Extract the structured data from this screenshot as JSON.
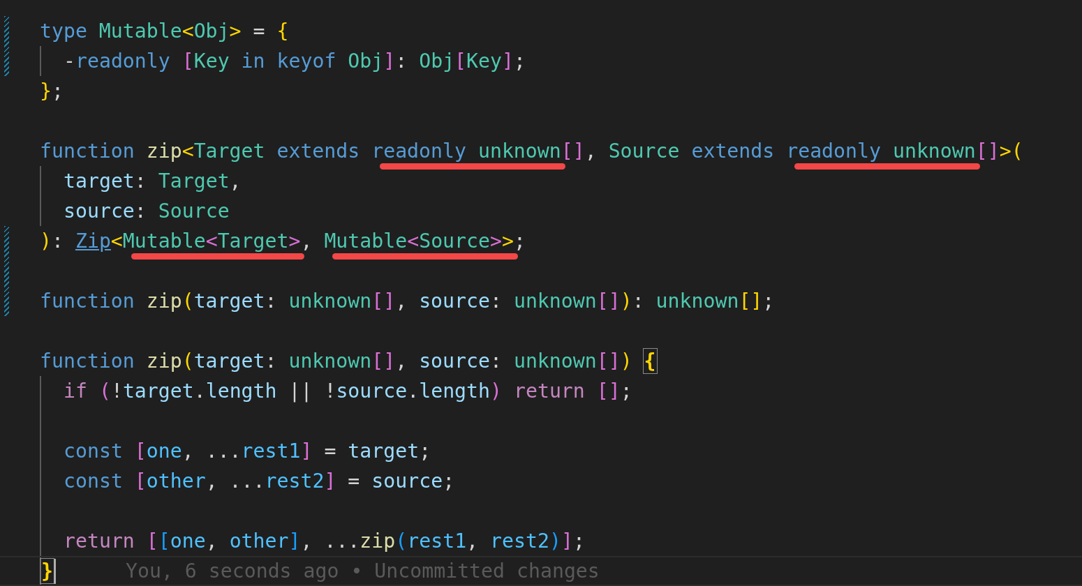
{
  "editor": {
    "lines": [
      {
        "modified": true,
        "indent": false,
        "tokens": [
          {
            "t": "type ",
            "color": "#569cd6"
          },
          {
            "t": "Mutable",
            "color": "#4ec9b0"
          },
          {
            "t": "<",
            "color": "#ffd700"
          },
          {
            "t": "Obj",
            "color": "#4ec9b0"
          },
          {
            "t": ">",
            "color": "#ffd700"
          },
          {
            "t": " = ",
            "color": "#d4d4d4"
          },
          {
            "t": "{",
            "color": "#ffd700"
          }
        ]
      },
      {
        "modified": true,
        "indent": true,
        "tokens": [
          {
            "t": "-",
            "color": "#d4d4d4"
          },
          {
            "t": "readonly ",
            "color": "#569cd6"
          },
          {
            "t": "[",
            "color": "#da70d6"
          },
          {
            "t": "Key ",
            "color": "#4ec9b0"
          },
          {
            "t": "in keyof ",
            "color": "#569cd6"
          },
          {
            "t": "Obj",
            "color": "#4ec9b0"
          },
          {
            "t": "]",
            "color": "#da70d6"
          },
          {
            "t": ": ",
            "color": "#d4d4d4"
          },
          {
            "t": "Obj",
            "color": "#4ec9b0"
          },
          {
            "t": "[",
            "color": "#da70d6"
          },
          {
            "t": "Key",
            "color": "#4ec9b0"
          },
          {
            "t": "]",
            "color": "#da70d6"
          },
          {
            "t": ";",
            "color": "#d4d4d4"
          }
        ]
      },
      {
        "modified": false,
        "indent": false,
        "tokens": [
          {
            "t": "}",
            "color": "#ffd700"
          },
          {
            "t": ";",
            "color": "#d4d4d4"
          }
        ]
      },
      {
        "modified": false,
        "indent": false
      },
      {
        "modified": false,
        "indent": false,
        "tokens": [
          {
            "t": "function ",
            "color": "#569cd6"
          },
          {
            "t": "zip",
            "color": "#dcdcaa"
          },
          {
            "t": "<",
            "color": "#ffd700"
          },
          {
            "t": "Target ",
            "color": "#4ec9b0"
          },
          {
            "t": "extends ",
            "color": "#569cd6"
          },
          {
            "marked": true,
            "tokens": [
              {
                "t": "readonly ",
                "color": "#569cd6"
              },
              {
                "t": "unknown",
                "color": "#4ec9b0"
              }
            ]
          },
          {
            "t": "[]",
            "color": "#da70d6"
          },
          {
            "t": ", ",
            "color": "#d4d4d4"
          },
          {
            "t": "Source ",
            "color": "#4ec9b0"
          },
          {
            "t": "extends ",
            "color": "#569cd6"
          },
          {
            "marked": true,
            "tokens": [
              {
                "t": "readonly ",
                "color": "#569cd6"
              },
              {
                "t": "unknown",
                "color": "#4ec9b0"
              }
            ]
          },
          {
            "t": "[]",
            "color": "#da70d6"
          },
          {
            "t": ">",
            "color": "#ffd700"
          },
          {
            "t": "(",
            "color": "#ffd700"
          }
        ]
      },
      {
        "modified": false,
        "indent": true,
        "tokens": [
          {
            "t": "target",
            "color": "#9cdcfe"
          },
          {
            "t": ": ",
            "color": "#d4d4d4"
          },
          {
            "t": "Target",
            "color": "#4ec9b0"
          },
          {
            "t": ",",
            "color": "#d4d4d4"
          }
        ]
      },
      {
        "modified": false,
        "indent": true,
        "tokens": [
          {
            "t": "source",
            "color": "#9cdcfe"
          },
          {
            "t": ": ",
            "color": "#d4d4d4"
          },
          {
            "t": "Source",
            "color": "#4ec9b0"
          }
        ]
      },
      {
        "modified": true,
        "indent": false,
        "tokens": [
          {
            "t": ")",
            "color": "#ffd700"
          },
          {
            "t": ": ",
            "color": "#d4d4d4"
          },
          {
            "t": "Zip",
            "color": "#569cd6",
            "link": true
          },
          {
            "t": "<",
            "color": "#ffd700"
          },
          {
            "marked": true,
            "tokens": [
              {
                "t": "Mutable",
                "color": "#4ec9b0"
              },
              {
                "t": "<",
                "color": "#da70d6"
              },
              {
                "t": "Target",
                "color": "#4ec9b0"
              },
              {
                "t": ">",
                "color": "#da70d6"
              }
            ]
          },
          {
            "t": ", ",
            "color": "#d4d4d4"
          },
          {
            "marked": true,
            "tokens": [
              {
                "t": "Mutable",
                "color": "#4ec9b0"
              },
              {
                "t": "<",
                "color": "#da70d6"
              },
              {
                "t": "Source",
                "color": "#4ec9b0"
              },
              {
                "t": ">",
                "color": "#da70d6"
              },
              {
                "t": ">",
                "color": "#ffd700"
              }
            ]
          },
          {
            "t": ";",
            "color": "#d4d4d4"
          }
        ]
      },
      {
        "modified": true,
        "indent": false
      },
      {
        "modified": true,
        "indent": false,
        "tokens": [
          {
            "t": "function ",
            "color": "#569cd6"
          },
          {
            "t": "zip",
            "color": "#dcdcaa"
          },
          {
            "t": "(",
            "color": "#ffd700"
          },
          {
            "t": "target",
            "color": "#9cdcfe"
          },
          {
            "t": ": ",
            "color": "#d4d4d4"
          },
          {
            "t": "unknown",
            "color": "#4ec9b0"
          },
          {
            "t": "[]",
            "color": "#da70d6"
          },
          {
            "t": ", ",
            "color": "#d4d4d4"
          },
          {
            "t": "source",
            "color": "#9cdcfe"
          },
          {
            "t": ": ",
            "color": "#d4d4d4"
          },
          {
            "t": "unknown",
            "color": "#4ec9b0"
          },
          {
            "t": "[]",
            "color": "#da70d6"
          },
          {
            "t": ")",
            "color": "#ffd700"
          },
          {
            "t": ": ",
            "color": "#d4d4d4"
          },
          {
            "t": "unknown",
            "color": "#4ec9b0"
          },
          {
            "t": "[]",
            "color": "#ffd700"
          },
          {
            "t": ";",
            "color": "#d4d4d4"
          }
        ]
      },
      {
        "modified": false,
        "indent": false
      },
      {
        "modified": false,
        "indent": false,
        "tokens": [
          {
            "t": "function ",
            "color": "#569cd6"
          },
          {
            "t": "zip",
            "color": "#dcdcaa"
          },
          {
            "t": "(",
            "color": "#ffd700"
          },
          {
            "t": "target",
            "color": "#9cdcfe"
          },
          {
            "t": ": ",
            "color": "#d4d4d4"
          },
          {
            "t": "unknown",
            "color": "#4ec9b0"
          },
          {
            "t": "[]",
            "color": "#da70d6"
          },
          {
            "t": ", ",
            "color": "#d4d4d4"
          },
          {
            "t": "source",
            "color": "#9cdcfe"
          },
          {
            "t": ": ",
            "color": "#d4d4d4"
          },
          {
            "t": "unknown",
            "color": "#4ec9b0"
          },
          {
            "t": "[]",
            "color": "#da70d6"
          },
          {
            "t": ") ",
            "color": "#ffd700"
          },
          {
            "t": "{",
            "color": "#ffd700",
            "matched": true
          }
        ]
      },
      {
        "modified": false,
        "indent": true,
        "tokens": [
          {
            "t": "if ",
            "color": "#c586c0"
          },
          {
            "t": "(",
            "color": "#da70d6"
          },
          {
            "t": "!",
            "color": "#d4d4d4"
          },
          {
            "t": "target",
            "color": "#9cdcfe"
          },
          {
            "t": ".",
            "color": "#d4d4d4"
          },
          {
            "t": "length",
            "color": "#9cdcfe"
          },
          {
            "t": " || !",
            "color": "#d4d4d4"
          },
          {
            "t": "source",
            "color": "#9cdcfe"
          },
          {
            "t": ".",
            "color": "#d4d4d4"
          },
          {
            "t": "length",
            "color": "#9cdcfe"
          },
          {
            "t": ") ",
            "color": "#da70d6"
          },
          {
            "t": "return ",
            "color": "#c586c0"
          },
          {
            "t": "[]",
            "color": "#da70d6"
          },
          {
            "t": ";",
            "color": "#d4d4d4"
          }
        ]
      },
      {
        "modified": false,
        "indent": true
      },
      {
        "modified": false,
        "indent": true,
        "tokens": [
          {
            "t": "const ",
            "color": "#569cd6"
          },
          {
            "t": "[",
            "color": "#da70d6"
          },
          {
            "t": "one",
            "color": "#4fc1ff"
          },
          {
            "t": ", ...",
            "color": "#d4d4d4"
          },
          {
            "t": "rest1",
            "color": "#4fc1ff"
          },
          {
            "t": "]",
            "color": "#da70d6"
          },
          {
            "t": " = ",
            "color": "#d4d4d4"
          },
          {
            "t": "target",
            "color": "#9cdcfe"
          },
          {
            "t": ";",
            "color": "#d4d4d4"
          }
        ]
      },
      {
        "modified": false,
        "indent": true,
        "tokens": [
          {
            "t": "const ",
            "color": "#569cd6"
          },
          {
            "t": "[",
            "color": "#da70d6"
          },
          {
            "t": "other",
            "color": "#4fc1ff"
          },
          {
            "t": ", ...",
            "color": "#d4d4d4"
          },
          {
            "t": "rest2",
            "color": "#4fc1ff"
          },
          {
            "t": "]",
            "color": "#da70d6"
          },
          {
            "t": " = ",
            "color": "#d4d4d4"
          },
          {
            "t": "source",
            "color": "#9cdcfe"
          },
          {
            "t": ";",
            "color": "#d4d4d4"
          }
        ]
      },
      {
        "modified": false,
        "indent": true
      },
      {
        "modified": false,
        "indent": true,
        "tokens": [
          {
            "t": "return ",
            "color": "#c586c0"
          },
          {
            "t": "[",
            "color": "#da70d6"
          },
          {
            "t": "[",
            "color": "#179fff"
          },
          {
            "t": "one",
            "color": "#4fc1ff"
          },
          {
            "t": ", ",
            "color": "#d4d4d4"
          },
          {
            "t": "other",
            "color": "#4fc1ff"
          },
          {
            "t": "]",
            "color": "#179fff"
          },
          {
            "t": ", ...",
            "color": "#d4d4d4"
          },
          {
            "t": "zip",
            "color": "#dcdcaa"
          },
          {
            "t": "(",
            "color": "#179fff"
          },
          {
            "t": "rest1",
            "color": "#4fc1ff"
          },
          {
            "t": ", ",
            "color": "#d4d4d4"
          },
          {
            "t": "rest2",
            "color": "#4fc1ff"
          },
          {
            "t": ")",
            "color": "#179fff"
          },
          {
            "t": "]",
            "color": "#da70d6"
          },
          {
            "t": ";",
            "color": "#d4d4d4"
          }
        ]
      },
      {
        "modified": false,
        "indent": false,
        "current": true,
        "cursor": true,
        "tokens": [
          {
            "t": "}",
            "color": "#ffd700",
            "matched": true
          }
        ],
        "blame": "You, 6 seconds ago • Uncommitted changes"
      }
    ]
  }
}
